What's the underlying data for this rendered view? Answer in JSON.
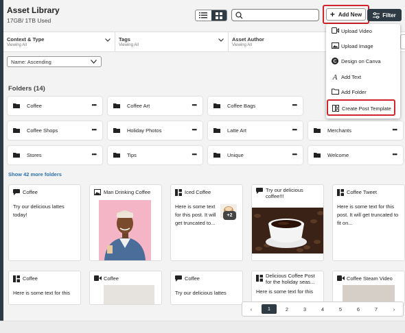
{
  "header": {
    "title": "Asset Library",
    "storage": "17GB/ 1TB Used"
  },
  "toolbar": {
    "add_new_label": "Add New",
    "filter_label": "Filter",
    "search_placeholder": ""
  },
  "filters": [
    {
      "title": "Context & Type",
      "sub": "Viewing All"
    },
    {
      "title": "Tags",
      "sub": "Viewing All"
    },
    {
      "title": "Asset Author",
      "sub": "Viewing All"
    }
  ],
  "sort": {
    "value": "Name: Ascending"
  },
  "folders": {
    "heading": "Folders (14)",
    "items": [
      "Coffee",
      "Coffee Art",
      "Coffee Bags",
      "Coffee Shops",
      "Holiday Photos",
      "Latte Art",
      "Merchants",
      "Stores",
      "Tips",
      "Unique",
      "Welcome"
    ],
    "more_label": "•••",
    "show_more": "Show 42 more folders"
  },
  "assets_row1": [
    {
      "icon": "speech-bubble-icon",
      "title": "Coffee",
      "body": "Try our delicious lattes today!"
    },
    {
      "icon": "image-icon",
      "title": "Man Drinking Coffee",
      "body": ""
    },
    {
      "icon": "template-icon",
      "title": "Iced Coffee",
      "body": "Here is some text for this post. It will get truncated to...",
      "badge": "+2"
    },
    {
      "icon": "speech-bubble-icon",
      "title": "Try our delicious coffee!!!",
      "body": ""
    },
    {
      "icon": "template-icon",
      "title": "Coffee Tweet",
      "body": "Here is some text for this post. It will get truncated to fit on..."
    }
  ],
  "assets_row2": [
    {
      "icon": "template-icon",
      "title": "Coffee",
      "body": "Here is some text for this"
    },
    {
      "icon": "video-icon",
      "title": "Coffee",
      "body": ""
    },
    {
      "icon": "speech-bubble-icon",
      "title": "Coffee",
      "body": "Try our delicious lattes"
    },
    {
      "icon": "template-icon",
      "title": "Delicious Coffee Post for the holiday seas...",
      "body": "Here is some text for this"
    },
    {
      "icon": "video-icon",
      "title": "Coffee Steam Video",
      "body": ""
    }
  ],
  "pagination": {
    "prev": "‹",
    "next": "›",
    "pages": [
      "1",
      "2",
      "3",
      "4",
      "5",
      "6",
      "7"
    ],
    "current": "1"
  },
  "add_menu": [
    {
      "icon": "video-icon",
      "label": "Upload Video"
    },
    {
      "icon": "image-icon",
      "label": "Upload Image"
    },
    {
      "icon": "canva-icon",
      "label": "Design on Canva"
    },
    {
      "icon": "text-icon",
      "label": "Add Text"
    },
    {
      "icon": "folder-outline-icon",
      "label": "Add Folder"
    },
    {
      "icon": "template-icon",
      "label": "Create Post Template"
    }
  ],
  "colors": {
    "dark": "#2f3b44",
    "highlight": "#d0232b",
    "link": "#2a6fb0"
  }
}
